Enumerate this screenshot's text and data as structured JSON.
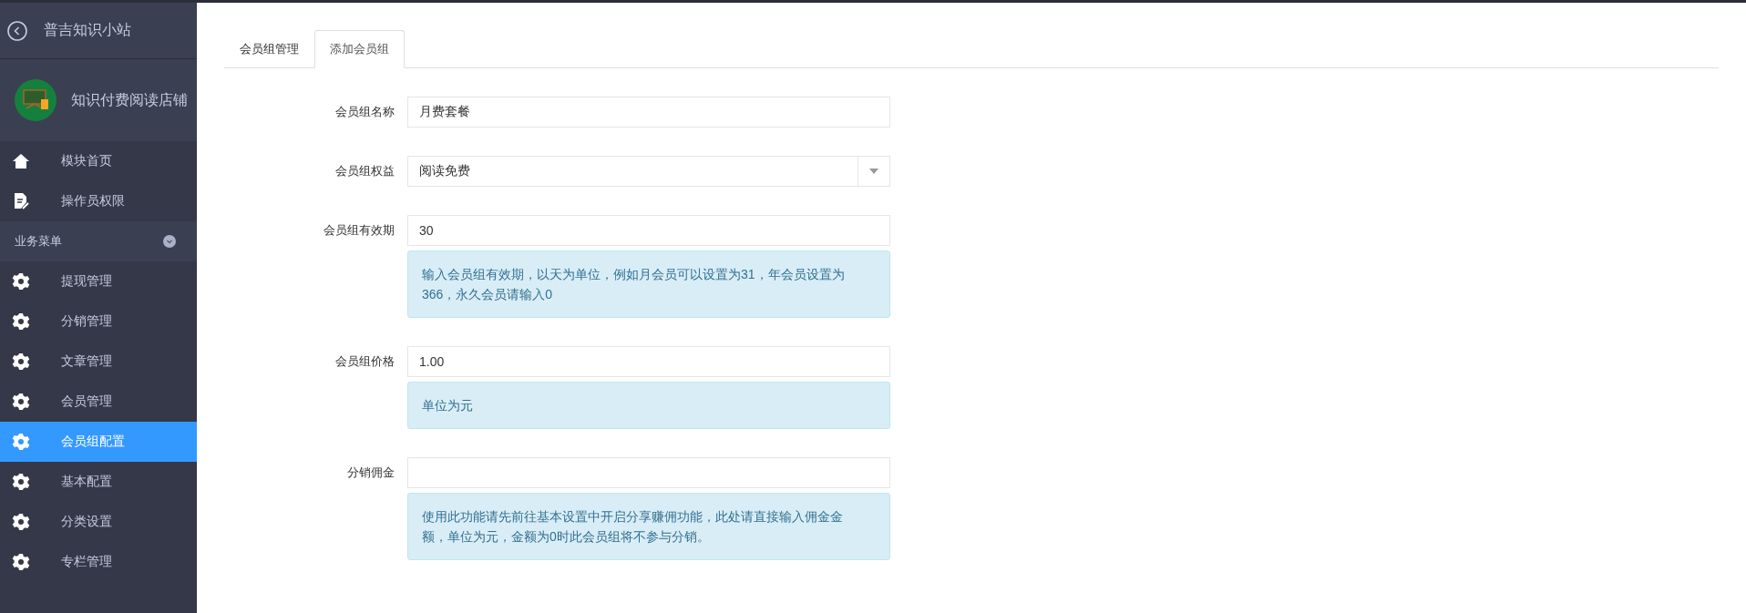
{
  "sidebar": {
    "back_title": "普吉知识小站",
    "store_name": "知识付费阅读店铺",
    "top_items": [
      {
        "label": "模块首页",
        "kind": "home",
        "selected": false
      },
      {
        "label": "操作员权限",
        "kind": "doc",
        "selected": false
      }
    ],
    "section": {
      "label": "业务菜单",
      "expanded": true
    },
    "items": [
      {
        "label": "提现管理",
        "selected": false
      },
      {
        "label": "分销管理",
        "selected": false
      },
      {
        "label": "文章管理",
        "selected": false
      },
      {
        "label": "会员管理",
        "selected": false
      },
      {
        "label": "会员组配置",
        "selected": true
      },
      {
        "label": "基本配置",
        "selected": false
      },
      {
        "label": "分类设置",
        "selected": false
      },
      {
        "label": "专栏管理",
        "selected": false
      }
    ]
  },
  "tabs": [
    {
      "label": "会员组管理",
      "selected": false
    },
    {
      "label": "添加会员组",
      "selected": true
    }
  ],
  "form": [
    {
      "label": "会员组名称",
      "kind": "text",
      "value": "月费套餐"
    },
    {
      "label": "会员组权益",
      "kind": "select",
      "value": "阅读免费"
    },
    {
      "label": "会员组有效期",
      "kind": "text",
      "value": "30",
      "help": "输入会员组有效期，以天为单位，例如月会员可以设置为31，年会员设置为366，永久会员请输入0"
    },
    {
      "label": "会员组价格",
      "kind": "text",
      "value": "1.00",
      "help": "单位为元"
    },
    {
      "label": "分销佣金",
      "kind": "text",
      "help": "使用此功能请先前往基本设置中开启分享赚佣功能，此处请直接输入佣金金额，单位为元，金额为0时此会员组将不参与分销。"
    }
  ]
}
